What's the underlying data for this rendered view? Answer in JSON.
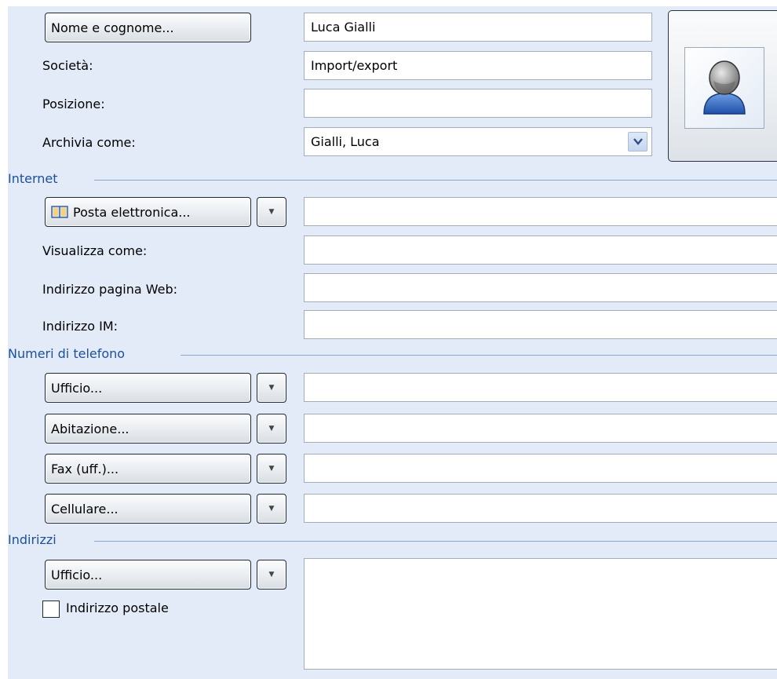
{
  "header": {
    "name_button": "Nome e cognome...",
    "name_value": "Luca Gialli",
    "company_label": "Società:",
    "company_value": "Import/export",
    "job_label": "Posizione:",
    "job_value": "",
    "file_as_label": "Archivia come:",
    "file_as_value": "Gialli, Luca"
  },
  "internet": {
    "title": "Internet",
    "email_button": "Posta elettronica...",
    "email_value": "",
    "display_as_label": "Visualizza come:",
    "display_as_value": "",
    "web_label": "Indirizzo pagina Web:",
    "web_value": "",
    "im_label": "Indirizzo IM:",
    "im_value": ""
  },
  "phones": {
    "title": "Numeri di telefono",
    "items": [
      {
        "label": "Ufficio...",
        "value": ""
      },
      {
        "label": "Abitazione...",
        "value": ""
      },
      {
        "label": "Fax (uff.)...",
        "value": ""
      },
      {
        "label": "Cellulare...",
        "value": ""
      }
    ]
  },
  "addresses": {
    "title": "Indirizzi",
    "type_button": "Ufficio...",
    "postal_checkbox_label": "Indirizzo postale",
    "postal_checked": false,
    "address_value": ""
  },
  "icons": {
    "dropdown": "▼",
    "combo_arrow": "chevron-down-icon",
    "address_book": "address-book-icon",
    "contact_photo": "contact-silhouette-icon"
  },
  "colors": {
    "panel": "#e2ebf7",
    "section_title": "#1d4f9a",
    "rule": "#8aa8cf"
  }
}
